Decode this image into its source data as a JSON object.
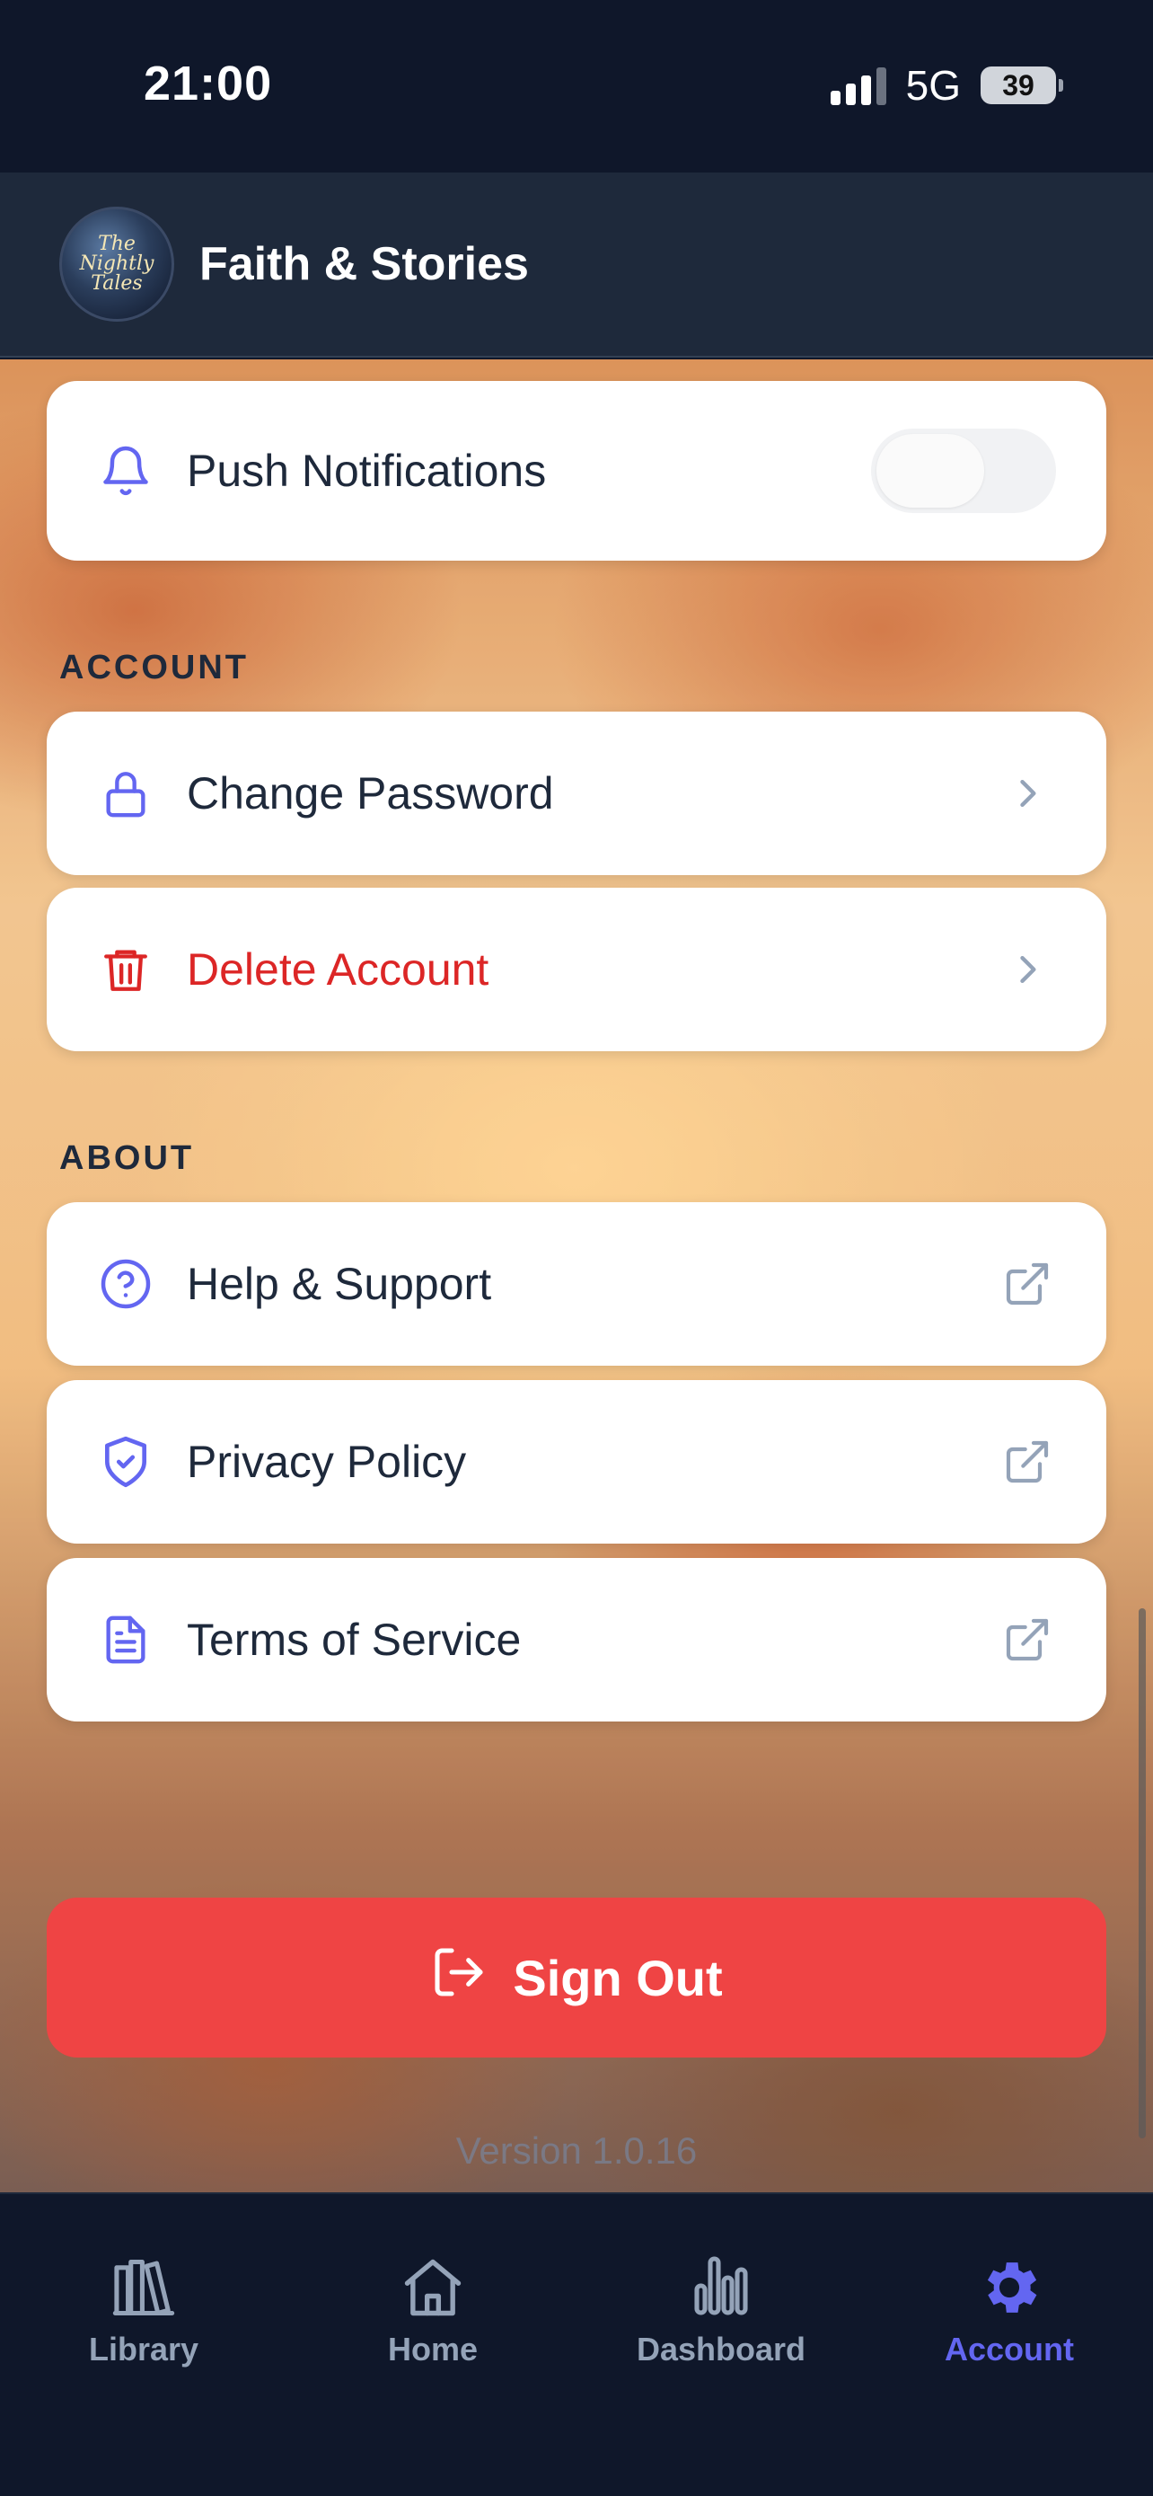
{
  "status_bar": {
    "time": "21:00",
    "network": "5G",
    "battery": "39"
  },
  "header": {
    "logo_text": "The Nightly Tales",
    "title": "Faith & Stories"
  },
  "settings": {
    "push_notifications": {
      "label": "Push Notifications",
      "enabled": false
    },
    "account_section": {
      "title": "ACCOUNT",
      "items": [
        {
          "label": "Change Password",
          "icon": "lock-icon"
        },
        {
          "label": "Delete Account",
          "icon": "trash-icon",
          "color": "#dc2626"
        }
      ]
    },
    "about_section": {
      "title": "ABOUT",
      "items": [
        {
          "label": "Help & Support",
          "icon": "help-circle-icon"
        },
        {
          "label": "Privacy Policy",
          "icon": "shield-check-icon"
        },
        {
          "label": "Terms of Service",
          "icon": "document-icon"
        }
      ]
    },
    "sign_out_label": "Sign Out",
    "version": "Version 1.0.16"
  },
  "tabs": [
    {
      "label": "Library",
      "icon": "library-icon",
      "active": false
    },
    {
      "label": "Home",
      "icon": "home-icon",
      "active": false
    },
    {
      "label": "Dashboard",
      "icon": "bar-chart-icon",
      "active": false
    },
    {
      "label": "Account",
      "icon": "gear-icon",
      "active": true
    }
  ],
  "colors": {
    "accent": "#6366f1",
    "danger": "#ef4444",
    "nav_bg": "#0f172a",
    "header_bg": "#1e293b"
  }
}
